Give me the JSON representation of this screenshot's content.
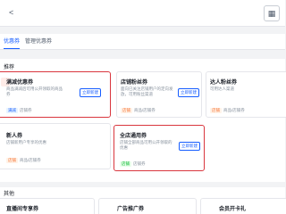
{
  "topbar": {
    "back_label": "<",
    "menu_icon": "grid-icon"
  },
  "tabs": [
    {
      "label": "优惠券"
    },
    {
      "label": "管理优惠券"
    }
  ],
  "section1": {
    "title": "推荐",
    "cards": [
      {
        "title": "满减优惠券",
        "desc": "商品满减后可用公开领取的商品券",
        "button": "立即新建",
        "tag": "满减",
        "tag_color": "#165dff",
        "footer": "店铺券"
      },
      {
        "title": "店铺粉丝券",
        "desc": "面向已关注店铺用户的定向发放，可用粉丝渠道",
        "button": "立即新建",
        "tag": "店铺",
        "tag_color": "#f77234",
        "footer": "商品/店铺券"
      },
      {
        "title": "达人粉丝券",
        "desc": "可用达人渠道",
        "button": "立即新建",
        "tag": "店铺",
        "tag_color": "#f77234",
        "footer": "商品/店铺券"
      },
      {
        "title": "新人券",
        "desc": "店铺新用户专享的优惠",
        "button": "立即新建",
        "tag": "店铺",
        "tag_color": "#f77234",
        "footer": "商品/店铺券"
      },
      {
        "title": "全店通用券",
        "desc": "店铺全部商品可用公开领取的优惠",
        "button": "立即新建",
        "tag": "店铺",
        "tag_color": "#00b42a",
        "footer": "店铺券"
      }
    ]
  },
  "section2": {
    "title": "其他",
    "cards": [
      {
        "title": "直播间专享券"
      },
      {
        "title": "广告推广券"
      },
      {
        "title": "会员开卡礼"
      }
    ]
  }
}
